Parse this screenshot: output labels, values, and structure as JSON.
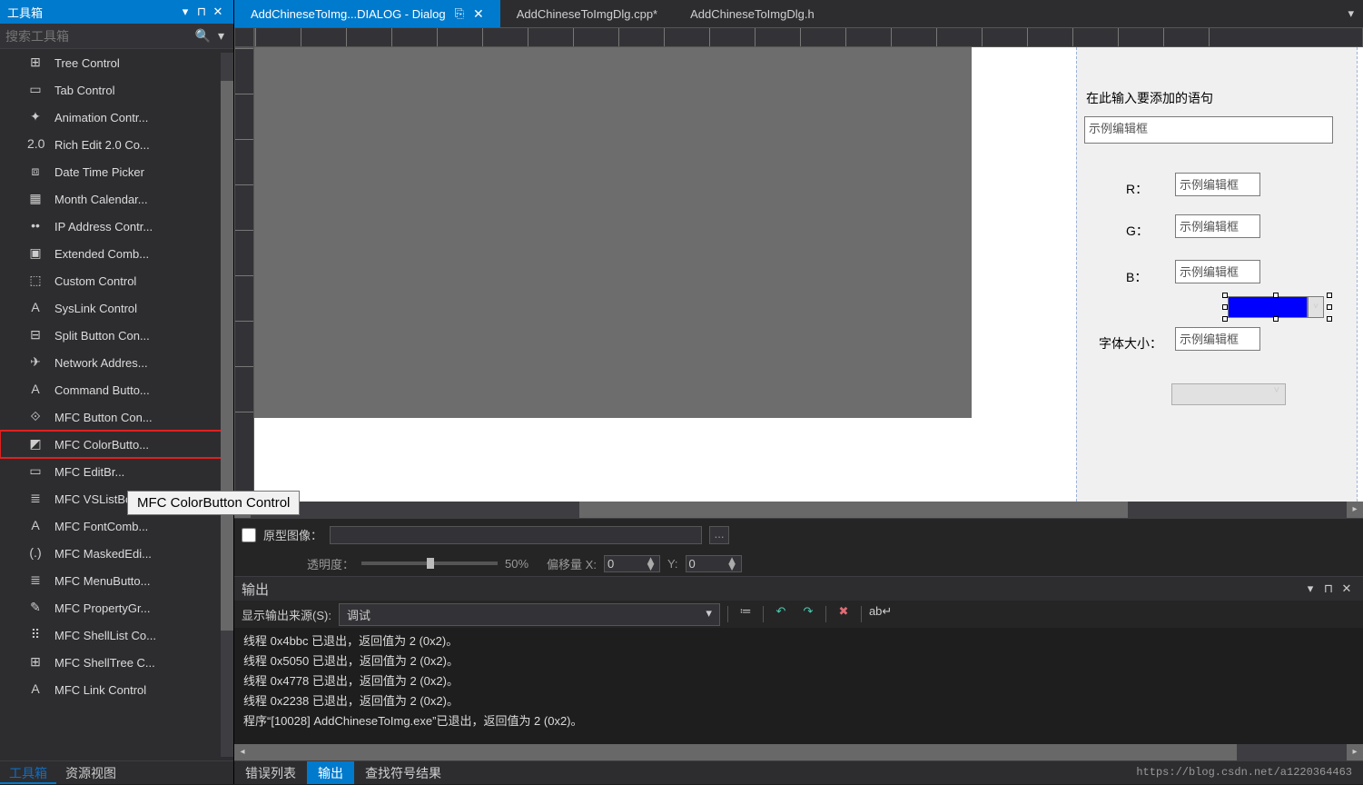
{
  "sidebar": {
    "title": "工具箱",
    "search_placeholder": "搜索工具箱",
    "items": [
      {
        "label": "Tree Control",
        "icon": "⊞"
      },
      {
        "label": "Tab Control",
        "icon": "▭"
      },
      {
        "label": "Animation Contr...",
        "icon": "✦"
      },
      {
        "label": "Rich Edit 2.0 Co...",
        "icon": "2.0"
      },
      {
        "label": "Date Time Picker",
        "icon": "⧈"
      },
      {
        "label": "Month Calendar...",
        "icon": "▦"
      },
      {
        "label": "IP Address Contr...",
        "icon": "••"
      },
      {
        "label": "Extended Comb...",
        "icon": "▣"
      },
      {
        "label": "Custom Control",
        "icon": "⬚"
      },
      {
        "label": "SysLink Control",
        "icon": "A"
      },
      {
        "label": "Split Button Con...",
        "icon": "⊟"
      },
      {
        "label": "Network Addres...",
        "icon": "✈"
      },
      {
        "label": "Command Butto...",
        "icon": "A"
      },
      {
        "label": "MFC Button Con...",
        "icon": "⟐"
      },
      {
        "label": "MFC ColorButto...",
        "icon": "◩",
        "hl": true
      },
      {
        "label": "MFC EditBr...",
        "icon": "▭"
      },
      {
        "label": "MFC VSListBox C...",
        "icon": "≣"
      },
      {
        "label": "MFC FontComb...",
        "icon": "A"
      },
      {
        "label": "MFC MaskedEdi...",
        "icon": "(.)"
      },
      {
        "label": "MFC MenuButto...",
        "icon": "≣"
      },
      {
        "label": "MFC PropertyGr...",
        "icon": "✎"
      },
      {
        "label": "MFC ShellList Co...",
        "icon": "⠿"
      },
      {
        "label": "MFC ShellTree C...",
        "icon": "⊞"
      },
      {
        "label": "MFC Link Control",
        "icon": "A"
      }
    ],
    "tabs": [
      {
        "label": "工具箱",
        "active": true
      },
      {
        "label": "资源视图",
        "active": false
      }
    ]
  },
  "tooltip": "MFC ColorButton Control",
  "doctabs": [
    {
      "label": "AddChineseToImg...DIALOG - Dialog",
      "active": true,
      "closeable": true,
      "pin": true
    },
    {
      "label": "AddChineseToImgDlg.cpp*",
      "active": false
    },
    {
      "label": "AddChineseToImgDlg.h",
      "active": false
    }
  ],
  "form": {
    "title": "在此输入要添加的语句",
    "main_edit": "示例编辑框",
    "r_label": "R：",
    "r_edit": "示例编辑框",
    "g_label": "G：",
    "g_edit": "示例编辑框",
    "b_label": "B：",
    "b_edit": "示例编辑框",
    "font_label": "字体大小：",
    "font_edit": "示例编辑框"
  },
  "status": {
    "proto_label": "原型图像：",
    "opacity_label": "透明度：",
    "slider_pct": "50%",
    "offx_label": "偏移量 X:",
    "offx": "0",
    "offy_label": "Y:",
    "offy": "0"
  },
  "output": {
    "title": "输出",
    "src_label": "显示输出来源(S):",
    "src_value": "调试",
    "lines": [
      "线程 0x4bbc 已退出，返回值为 2 (0x2)。",
      "线程 0x5050 已退出，返回值为 2 (0x2)。",
      "线程 0x4778 已退出，返回值为 2 (0x2)。",
      "线程 0x2238 已退出，返回值为 2 (0x2)。",
      "程序“[10028] AddChineseToImg.exe”已退出，返回值为 2 (0x2)。"
    ]
  },
  "bottabs": [
    {
      "label": "错误列表",
      "active": false
    },
    {
      "label": "输出",
      "active": true
    },
    {
      "label": "查找符号结果",
      "active": false
    }
  ],
  "watermark": "https://blog.csdn.net/a1220364463"
}
